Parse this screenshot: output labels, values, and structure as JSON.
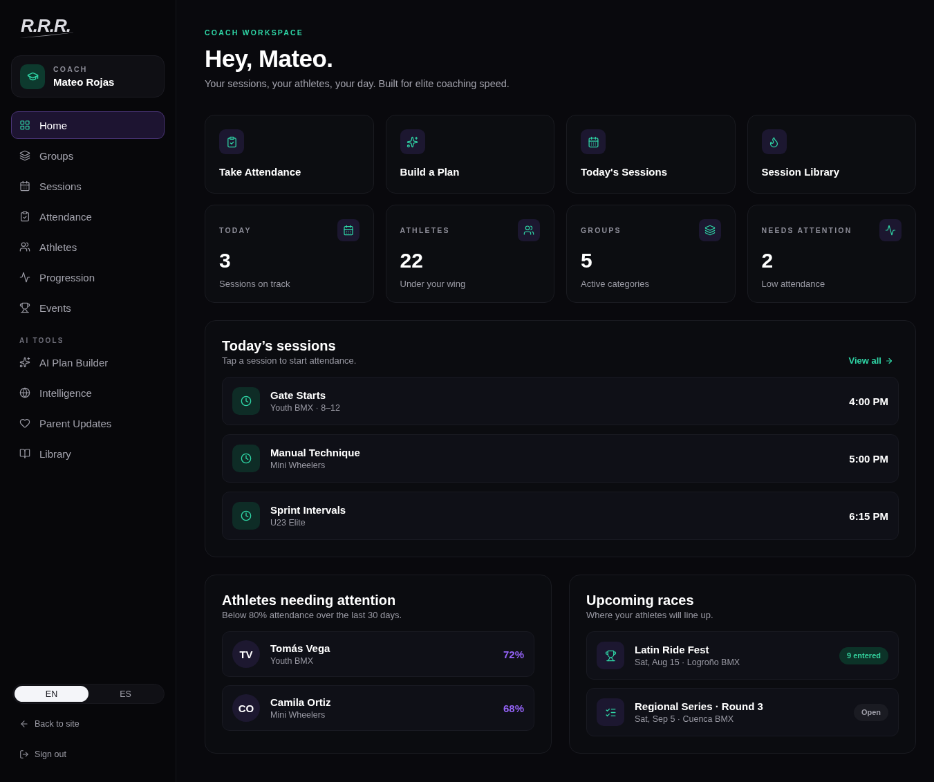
{
  "sidebar": {
    "logo": "R.R.R.",
    "profile": {
      "role": "COACH",
      "name": "Mateo Rojas"
    },
    "nav": [
      {
        "label": "Home",
        "selected": true
      },
      {
        "label": "Groups",
        "selected": false
      },
      {
        "label": "Sessions",
        "selected": false
      },
      {
        "label": "Attendance",
        "selected": false
      },
      {
        "label": "Athletes",
        "selected": false
      },
      {
        "label": "Progression",
        "selected": false
      },
      {
        "label": "Events",
        "selected": false
      }
    ],
    "section_label": "AI TOOLS",
    "ai_nav": [
      {
        "label": "AI Plan Builder",
        "selected": false
      },
      {
        "label": "Intelligence",
        "selected": false
      },
      {
        "label": "Parent Updates",
        "selected": false
      },
      {
        "label": "Library",
        "selected": false
      }
    ],
    "language": [
      {
        "label": "EN",
        "selected": true
      },
      {
        "label": "ES",
        "selected": false
      }
    ],
    "footer_links": [
      "Back to site",
      "Sign out"
    ]
  },
  "header": {
    "eyebrow": "COACH WORKSPACE",
    "title": "Hey, Mateo.",
    "subtitle": "Your sessions, your athletes, your day. Built for elite coaching speed."
  },
  "quick_actions": [
    {
      "label": "Take Attendance"
    },
    {
      "label": "Build a Plan"
    },
    {
      "label": "Today's Sessions"
    },
    {
      "label": "Session Library"
    }
  ],
  "stats": [
    {
      "label": "TODAY",
      "value": "3",
      "caption": "Sessions on track"
    },
    {
      "label": "ATHLETES",
      "value": "22",
      "caption": "Under your wing"
    },
    {
      "label": "GROUPS",
      "value": "5",
      "caption": "Active categories"
    },
    {
      "label": "NEEDS ATTENTION",
      "value": "2",
      "caption": "Low attendance"
    }
  ],
  "todays_sessions": {
    "title": "Today’s sessions",
    "subtitle": "Tap a session to start attendance.",
    "link": "View all",
    "rows": [
      {
        "name": "Gate Starts",
        "group": "Youth BMX · 8–12",
        "time": "4:00 PM"
      },
      {
        "name": "Manual Technique",
        "group": "Mini Wheelers",
        "time": "5:00 PM"
      },
      {
        "name": "Sprint Intervals",
        "group": "U23 Elite",
        "time": "6:15 PM"
      }
    ]
  },
  "attention": {
    "title": "Athletes needing attention",
    "subtitle": "Below 80% attendance over the last 30 days.",
    "athletes": [
      {
        "initials": "TV",
        "name": "Tomás Vega",
        "group": "Youth BMX",
        "rate": "72%"
      },
      {
        "initials": "CO",
        "name": "Camila Ortiz",
        "group": "Mini Wheelers",
        "rate": "68%"
      }
    ]
  },
  "races": {
    "title": "Upcoming races",
    "subtitle": "Where your athletes will line up.",
    "items": [
      {
        "name": "Latin Ride Fest",
        "details": "Sat, Aug 15 · Logroño BMX",
        "badge": "9 entered",
        "kind": "entered"
      },
      {
        "name": "Regional Series · Round 3",
        "details": "Sat, Sep 5 · Cuenca BMX",
        "badge": "Open",
        "kind": "open"
      }
    ]
  }
}
